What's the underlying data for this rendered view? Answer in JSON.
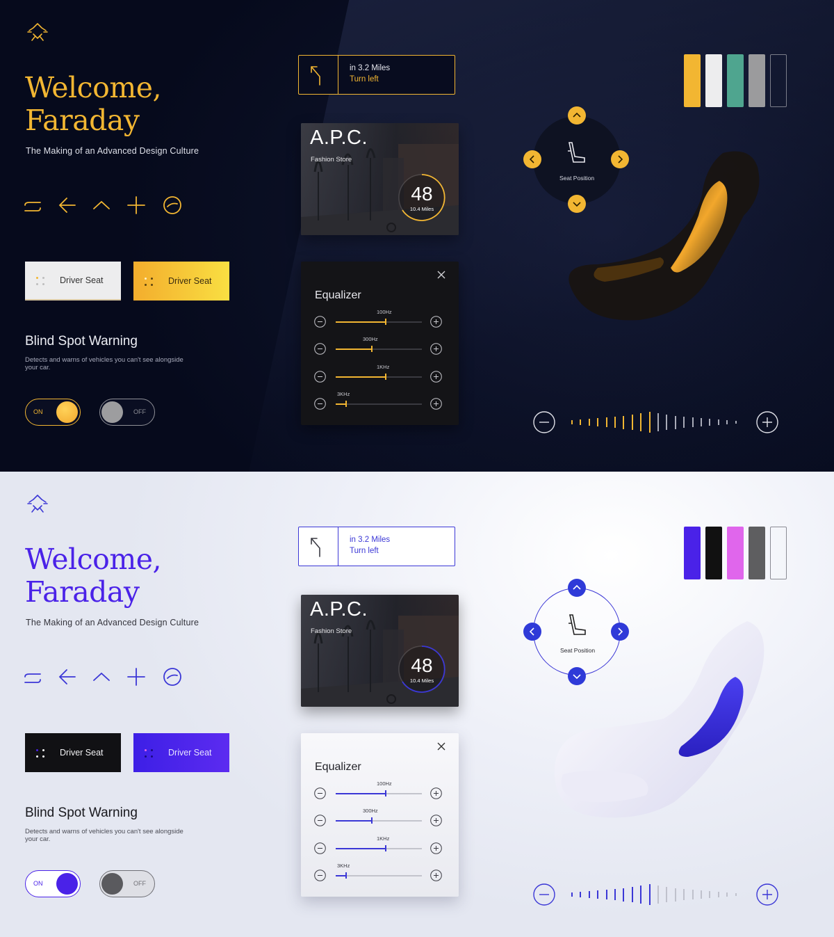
{
  "brand": {
    "logo_icon": "faraday-logo-icon"
  },
  "themes": [
    {
      "id": "dark",
      "accent": "#F2B632",
      "welcome_line1": "Welcome,",
      "welcome_line2": "Faraday",
      "tagline": "The Making of an Advanced Design Culture",
      "icons": [
        "lane-change-icon",
        "arrow-left-icon",
        "chevron-up-icon",
        "plus-icon",
        "speedometer-icon"
      ],
      "seat_buttons": [
        {
          "label": "Driver Seat",
          "style": "neutral"
        },
        {
          "label": "Driver Seat",
          "style": "accent"
        }
      ],
      "blind_spot": {
        "title": "Blind Spot Warning",
        "description": "Detects and warns of vehicles you can't see alongside your car."
      },
      "toggles": [
        {
          "label": "ON",
          "state": "on"
        },
        {
          "label": "OFF",
          "state": "off"
        }
      ],
      "navigation": {
        "distance": "in 3.2 Miles",
        "instruction": "Turn left",
        "icon": "turn-left-arrow-icon"
      },
      "store": {
        "name": "A.P.C.",
        "category": "Fashion Store",
        "value": "48",
        "distance": "10.4 Miles"
      },
      "equalizer": {
        "title": "Equalizer",
        "bands": [
          {
            "label": "100Hz",
            "level": 0.57
          },
          {
            "label": "300Hz",
            "level": 0.41
          },
          {
            "label": "1KHz",
            "level": 0.57
          },
          {
            "label": "3KHz",
            "level": 0.11
          }
        ]
      },
      "palette": [
        "#F2B632",
        "#EDEDEE",
        "#4FA58F",
        "#9B9B9D",
        "outline"
      ],
      "seat_control": {
        "label": "Seat Position",
        "icon": "seat-icon"
      },
      "volume": {
        "level": 0.5
      }
    },
    {
      "id": "light",
      "accent": "#4A22E8",
      "welcome_line1": "Welcome,",
      "welcome_line2": "Faraday",
      "tagline": "The Making of an Advanced Design Culture",
      "icons": [
        "lane-change-icon",
        "arrow-left-icon",
        "chevron-up-icon",
        "plus-icon",
        "speedometer-icon"
      ],
      "seat_buttons": [
        {
          "label": "Driver Seat",
          "style": "neutral"
        },
        {
          "label": "Driver Seat",
          "style": "accent"
        }
      ],
      "blind_spot": {
        "title": "Blind Spot Warning",
        "description": "Detects and warns of vehicles you can't see alongside your car."
      },
      "toggles": [
        {
          "label": "ON",
          "state": "on"
        },
        {
          "label": "OFF",
          "state": "off"
        }
      ],
      "navigation": {
        "distance": "in 3.2 Miles",
        "instruction": "Turn left",
        "icon": "turn-left-arrow-icon"
      },
      "store": {
        "name": "A.P.C.",
        "category": "Fashion Store",
        "value": "48",
        "distance": "10.4 Miles"
      },
      "equalizer": {
        "title": "Equalizer",
        "bands": [
          {
            "label": "100Hz",
            "level": 0.57
          },
          {
            "label": "300Hz",
            "level": 0.41
          },
          {
            "label": "1KHz",
            "level": 0.57
          },
          {
            "label": "3KHz",
            "level": 0.11
          }
        ]
      },
      "palette": [
        "#4A22E8",
        "#111111",
        "#E066EC",
        "#5E5E60",
        "outline"
      ],
      "seat_control": {
        "label": "Seat Position",
        "icon": "seat-icon"
      },
      "volume": {
        "level": 0.5
      }
    }
  ]
}
